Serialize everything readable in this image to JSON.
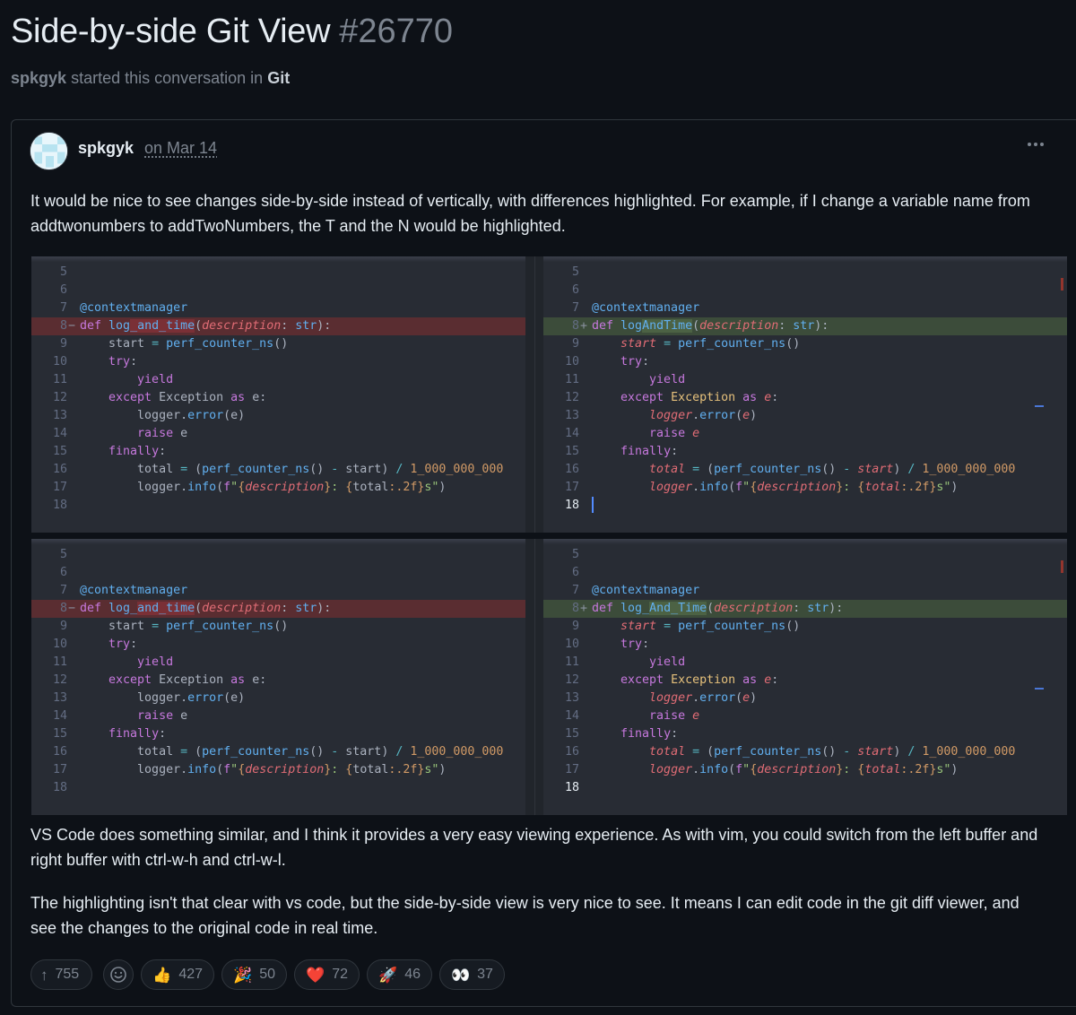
{
  "discussion": {
    "title": "Side-by-side Git View",
    "number": "#26770",
    "starter": "spkgyk",
    "started_text": "started this conversation in",
    "category": "Git"
  },
  "post": {
    "author": "spkgyk",
    "date": "on Mar 14",
    "more_label": "More options",
    "paragraph1": "It would be nice to see changes side-by-side instead of vertically, with differences highlighted. For example, if I change a variable name from addtwonumbers to addTwoNumbers, the T and the N would be highlighted.",
    "paragraph2": "VS Code does something similar, and I think it provides a very easy viewing experience. As with vim, you could switch from the left buffer and right buffer with ctrl-w-h and ctrl-w-l.",
    "paragraph3": "The highlighting isn't that clear with vs code, but the side-by-side view is very nice to see. It means I can edit code in the git diff viewer, and see the changes to the original code in real time."
  },
  "screenshots": [
    {
      "left_fn": "log_and_time",
      "right_fn": "logAndTime",
      "line_numbers": [
        "5",
        "6",
        "7",
        "8",
        "9",
        "10",
        "11",
        "12",
        "13",
        "14",
        "15",
        "16",
        "17",
        "18"
      ],
      "left_marker": "−",
      "right_marker": "+"
    },
    {
      "left_fn": "log_and_time",
      "right_fn": "log_And_Time",
      "line_numbers": [
        "5",
        "6",
        "7",
        "8",
        "9",
        "10",
        "11",
        "12",
        "13",
        "14",
        "15",
        "16",
        "17",
        "18"
      ],
      "left_marker": "−",
      "right_marker": "+"
    }
  ],
  "code": {
    "decorator": "@contextmanager",
    "def_kw": "def",
    "param": "description",
    "param_type": "str",
    "l9_a": "start",
    "l9_fn": "perf_counter_ns",
    "l10": "try",
    "l11": "yield",
    "l12_kw": "except",
    "l12_ty": "Exception",
    "l12_as": "as",
    "l12_var": "e",
    "l13_obj": "logger",
    "l13_fn": "error",
    "l14_kw": "raise",
    "l15": "finally",
    "l16_var": "total",
    "l16_num": "1_000_000_000",
    "l17_fn": "info",
    "l17_fmt": ":.2f",
    "l17_unit": "s"
  },
  "reactions": [
    {
      "name": "upvote",
      "emoji": "↑",
      "count": "755"
    },
    {
      "name": "thumbs-up",
      "emoji": "👍",
      "count": "427"
    },
    {
      "name": "tada",
      "emoji": "🎉",
      "count": "50"
    },
    {
      "name": "heart",
      "emoji": "❤️",
      "count": "72"
    },
    {
      "name": "rocket",
      "emoji": "🚀",
      "count": "46"
    },
    {
      "name": "eyes",
      "emoji": "👀",
      "count": "37"
    }
  ],
  "colors": {
    "background": "#0d1117",
    "border": "#30363d",
    "muted": "#7d8590",
    "text": "#e6edf3",
    "diff_deleted": "#5a2d31",
    "diff_added": "#3c4c3a"
  }
}
